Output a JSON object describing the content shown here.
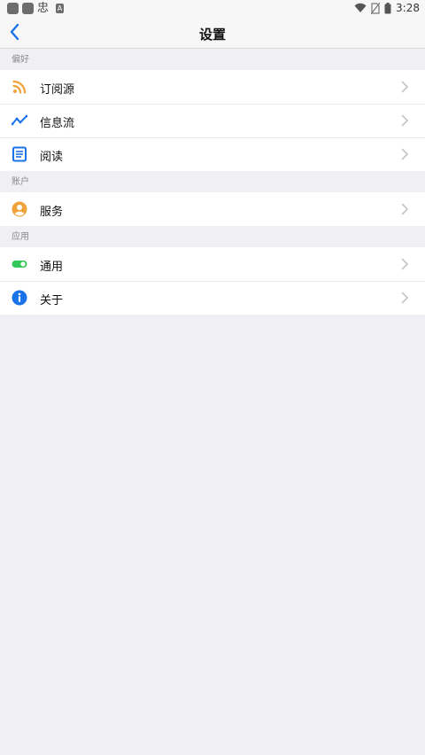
{
  "status_bar": {
    "time": "3:28",
    "left_glyph": "忠",
    "icons": [
      "app-icon",
      "app-icon",
      "notification-icon",
      "a-icon",
      "wifi-icon",
      "no-sim-icon",
      "battery-icon"
    ]
  },
  "nav": {
    "title": "设置",
    "back_icon": "chevron-left-icon"
  },
  "sections": [
    {
      "header": "偏好",
      "items": [
        {
          "label": "订阅源",
          "icon": "rss-icon",
          "color": "#f0a33a"
        },
        {
          "label": "信息流",
          "icon": "trend-line-icon",
          "color": "#1a73e8"
        },
        {
          "label": "阅读",
          "icon": "document-icon",
          "color": "#1a73e8"
        }
      ]
    },
    {
      "header": "账户",
      "items": [
        {
          "label": "服务",
          "icon": "user-circle-icon",
          "color": "#f0a33a"
        }
      ]
    },
    {
      "header": "应用",
      "items": [
        {
          "label": "通用",
          "icon": "toggle-icon",
          "color": "#34c759"
        },
        {
          "label": "关于",
          "icon": "info-icon",
          "color": "#1a73e8"
        }
      ]
    }
  ],
  "colors": {
    "background": "#efeff4",
    "accent": "#1a73e8",
    "chevron": "#c4c4c8"
  }
}
